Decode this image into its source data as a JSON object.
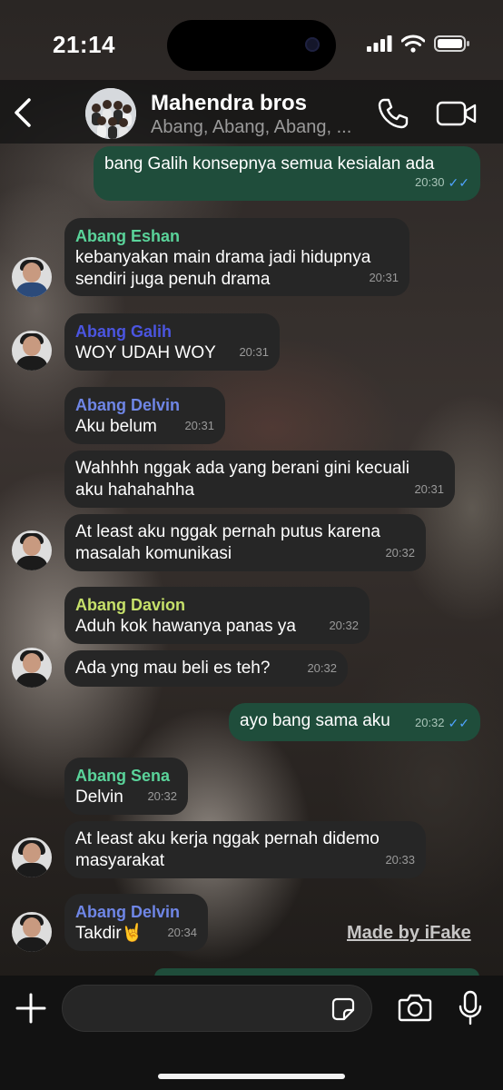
{
  "status": {
    "time": "21:14"
  },
  "header": {
    "title": "Mahendra bros",
    "subtitle": "Abang, Abang, Abang, ..."
  },
  "colors": {
    "outgoing_bubble": "#1f4d3b",
    "incoming_bubble": "#262626",
    "read_tick": "#4fa3ff",
    "eshan": "#5ad39a",
    "galih": "#4b55e0",
    "delvin": "#6f86e6",
    "davion": "#c6e06a",
    "sena": "#5ad39a"
  },
  "messages": [
    {
      "dir": "out",
      "text": "bang Galih konsepnya semua kesialan ada",
      "time": "20:30",
      "ticks": "✓✓"
    },
    {
      "dir": "in",
      "sender": "Abang Eshan",
      "text": "kebanyakan main drama jadi hidupnya\nsendiri juga penuh drama",
      "time": "20:31"
    },
    {
      "dir": "in",
      "sender": "Abang Galih",
      "text": "WOY UDAH WOY",
      "time": "20:31"
    },
    {
      "dir": "in",
      "sender": "Abang Delvin",
      "text": "Aku belum",
      "time": "20:31"
    },
    {
      "dir": "in",
      "text": "Wahhhh nggak ada yang berani gini kecuali\naku hahahahha",
      "time": "20:31"
    },
    {
      "dir": "in",
      "text": "At least aku nggak pernah putus karena\nmasalah komunikasi",
      "time": "20:32"
    },
    {
      "dir": "in",
      "sender": "Abang Davion",
      "text": "Aduh kok hawanya panas ya",
      "time": "20:32"
    },
    {
      "dir": "in",
      "text": "Ada yng mau beli es teh?",
      "time": "20:32"
    },
    {
      "dir": "out",
      "text": "ayo bang sama aku",
      "time": "20:32",
      "ticks": "✓✓"
    },
    {
      "dir": "in",
      "sender": "Abang Sena",
      "text": "Delvin",
      "time": "20:32"
    },
    {
      "dir": "in",
      "text": "At least aku kerja nggak pernah didemo\nmasyarakat",
      "time": "20:33"
    },
    {
      "dir": "in",
      "sender": "Abang Delvin",
      "text": "Takdir🤘",
      "time": "20:34"
    }
  ],
  "watermark": "Made by iFake"
}
